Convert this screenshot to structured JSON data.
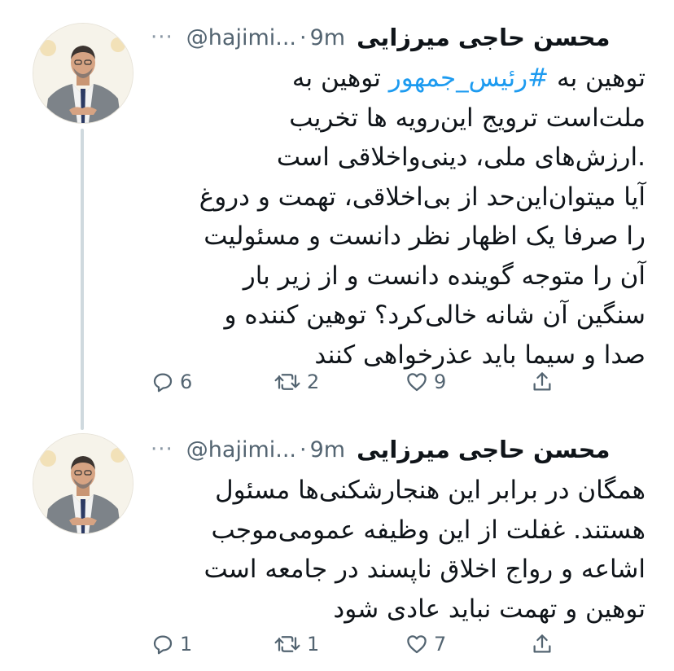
{
  "tweets": [
    {
      "display_name": "محسن حاجی میرزایی",
      "handle": "@hajimi...",
      "time": "9m",
      "lines": [
        {
          "before": "توهین به ",
          "hashtag": "#رئیس_جمهور",
          "after": " توهین به"
        },
        {
          "text": "ملت‌است ترویج این‌رویه ها تخریب"
        },
        {
          "text": ".ارزش‌های ملی، دینی‌واخلاقی است"
        },
        {
          "text": "آیا میتوان‌این‌حد از بی‌اخلاقی، تهمت و دروغ"
        },
        {
          "text": "را صرفا یک اظهار نظر دانست و مسئولیت"
        },
        {
          "text": "آن را متوجه گوینده دانست و از زیر بار"
        },
        {
          "text": "سنگین آن شانه خالی‌کرد؟ توهین کننده و"
        },
        {
          "text": "صدا و سیما باید عذرخواهی کنند"
        }
      ],
      "replies": "6",
      "retweets": "2",
      "likes": "9"
    },
    {
      "display_name": "محسن حاجی میرزایی",
      "handle": "@hajimi...",
      "time": "9m",
      "lines": [
        {
          "text": "همگان در برابر این هنجارشکنی‌ها مسئول"
        },
        {
          "text": "هستند. غفلت از این وظیفه عمومی‌موجب"
        },
        {
          "text": "اشاعه و رواج اخلاق ناپسند در جامعه است"
        },
        {
          "text": "توهین و تهمت نباید عادی شود"
        }
      ],
      "replies": "1",
      "retweets": "1",
      "likes": "7"
    }
  ],
  "more_label": "···",
  "dot": "·",
  "icons": {
    "reply": "reply-icon",
    "retweet": "retweet-icon",
    "like": "heart-icon",
    "share": "share-icon",
    "more": "more-icon"
  },
  "colors": {
    "hashtag": "#1d9bf0",
    "muted": "#536471",
    "thread_line": "#cfd9de"
  }
}
